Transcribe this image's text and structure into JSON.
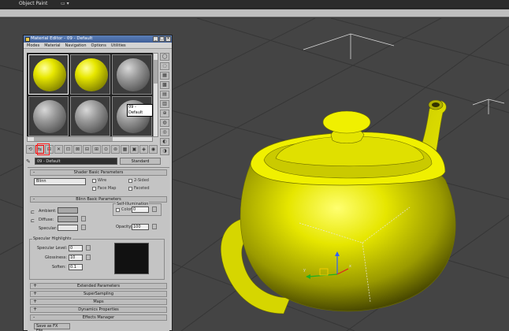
{
  "topbar": {
    "object_label": "Object Paint",
    "selector": "▭ ▾"
  },
  "material_editor": {
    "title": "Material Editor - 09 - Default",
    "window_buttons": [
      "_",
      "□",
      "×"
    ],
    "menu": [
      "Modes",
      "Material",
      "Navigation",
      "Options",
      "Utilities"
    ],
    "tooltip": "09 - Default",
    "material_name": "09 - Default",
    "material_type": "Standard",
    "toolbar_icons": [
      "⟲",
      "⇆",
      "⊞",
      "✕",
      "⊡",
      "⊠",
      "⊟",
      "⊞",
      "⊙",
      "⊚",
      "▦",
      "▣",
      "◈",
      "◉"
    ],
    "side_icons": [
      "◯",
      "◌",
      "▦",
      "▩",
      "▤",
      "▥",
      "⊕",
      "◍",
      "◎",
      "◐",
      "◑"
    ],
    "shader_basic": {
      "header": "Shader Basic Parameters",
      "shader": "Blinn",
      "options": [
        "Wire",
        "2-Sided",
        "Face Map",
        "Faceted"
      ]
    },
    "blinn_basic": {
      "header": "Blinn Basic Parameters",
      "self_illum_group": "Self-Illumination",
      "color_label": "Color",
      "color_value": "0",
      "ambient_label": "Ambient:",
      "diffuse_label": "Diffuse:",
      "specular_label": "Specular:",
      "opacity_label": "Opacity:",
      "opacity_value": "100",
      "specular_group": "Specular Highlights",
      "specular_level_label": "Specular Level:",
      "specular_level_value": "0",
      "glossiness_label": "Glossiness:",
      "glossiness_value": "10",
      "soften_label": "Soften:",
      "soften_value": "0.1"
    },
    "rollouts": [
      "Extended Parameters",
      "SuperSampling",
      "Maps",
      "Dynamics Properties",
      "Effects Manager"
    ],
    "bottom_button": "Save as FX File..."
  },
  "colors": {
    "teapot": "#e6e600",
    "viewport_bg": "#444444",
    "grid": "#3a3a3a"
  }
}
